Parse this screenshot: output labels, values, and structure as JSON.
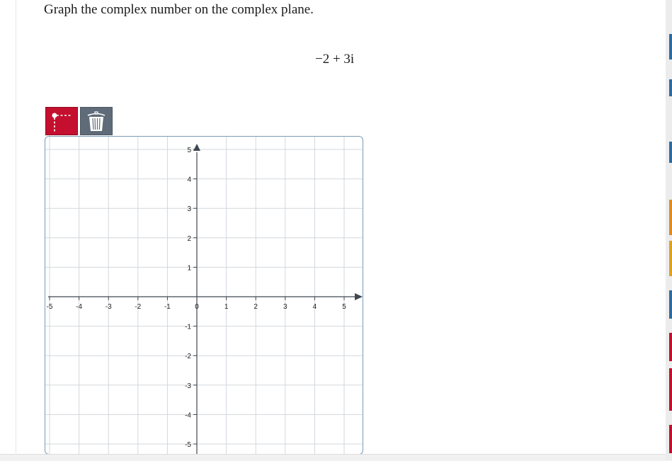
{
  "prompt": "Graph the complex number on the complex plane.",
  "expression": "−2 + 3i",
  "toolbar": {
    "point_tool": "point-plot-icon",
    "delete_tool": "trash-icon",
    "accent": "#c40f2e",
    "secondary": "#5f6b78"
  },
  "chart_data": {
    "type": "scatter",
    "title": "",
    "xlabel": "",
    "ylabel": "",
    "xlim": [
      -5,
      5
    ],
    "ylim": [
      -5,
      5
    ],
    "grid": true,
    "x_ticks": [
      -5,
      -4,
      -3,
      -2,
      -1,
      0,
      1,
      2,
      3,
      4,
      5
    ],
    "y_ticks": [
      5,
      4,
      3,
      2,
      1,
      -1,
      -2,
      -3,
      -4,
      -5
    ],
    "series": []
  }
}
